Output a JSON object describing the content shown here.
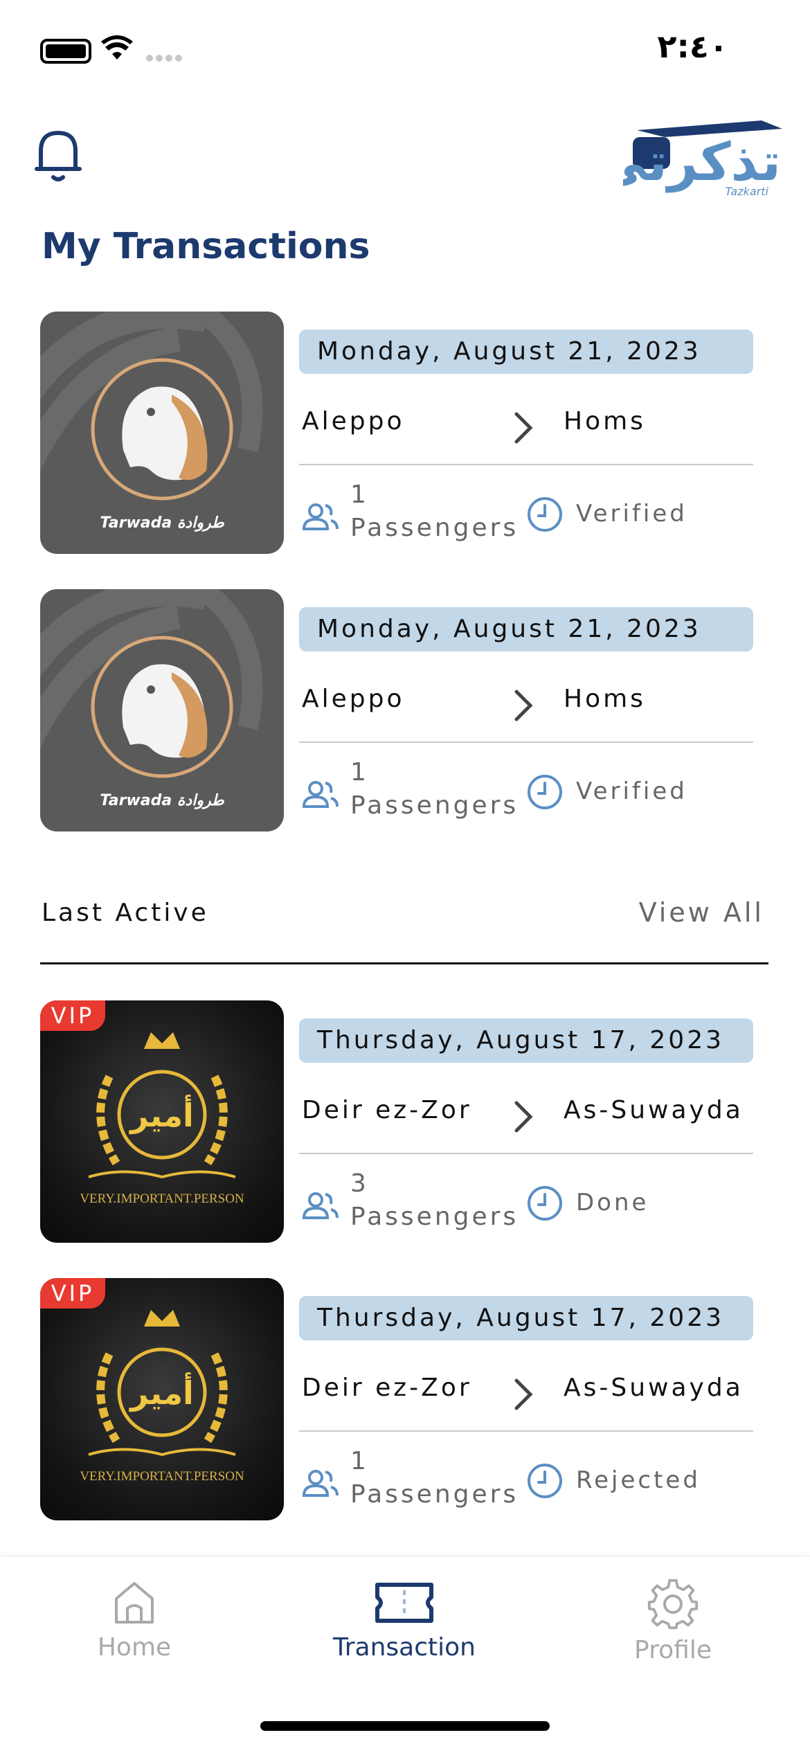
{
  "status_bar": {
    "time": "٢:٤٠"
  },
  "header": {
    "logo_text": "تذكرتي",
    "logo_subtitle": "Tazkarti",
    "title": "My Transactions"
  },
  "transactions": [
    {
      "company": "Tarwada طروادة",
      "date": "Monday, August 21, 2023",
      "from": "Aleppo",
      "to": "Homs",
      "passengers_count": "1",
      "passengers_label": "Passengers",
      "status": "Verified"
    },
    {
      "company": "Tarwada طروادة",
      "date": "Monday, August 21, 2023",
      "from": "Aleppo",
      "to": "Homs",
      "passengers_count": "1",
      "passengers_label": "Passengers",
      "status": "Verified"
    }
  ],
  "last_active": {
    "title": "Last Active",
    "view_all": "View All",
    "items": [
      {
        "badge": "VIP",
        "logo_text": "أمير",
        "logo_caption": "VERY.IMPORTANT.PERSON",
        "date": "Thursday, August 17, 2023",
        "from": "Deir ez-Zor",
        "to": "As-Suwayda",
        "passengers_count": "3",
        "passengers_label": "Passengers",
        "status": "Done"
      },
      {
        "badge": "VIP",
        "logo_text": "أمير",
        "logo_caption": "VERY.IMPORTANT.PERSON",
        "date": "Thursday, August 17, 2023",
        "from": "Deir ez-Zor",
        "to": "As-Suwayda",
        "passengers_count": "1",
        "passengers_label": "Passengers",
        "status": "Rejected"
      }
    ]
  },
  "bottom_nav": {
    "items": [
      {
        "label": "Home",
        "icon": "home-icon",
        "active": false
      },
      {
        "label": "Transaction",
        "icon": "ticket-icon",
        "active": true
      },
      {
        "label": "Profile",
        "icon": "gear-icon",
        "active": false
      }
    ]
  },
  "colors": {
    "accent": "#1d3a6e",
    "date_pill": "#c2d7e8",
    "vip": "#e83a30",
    "icon_blue": "#5a8fc4"
  }
}
